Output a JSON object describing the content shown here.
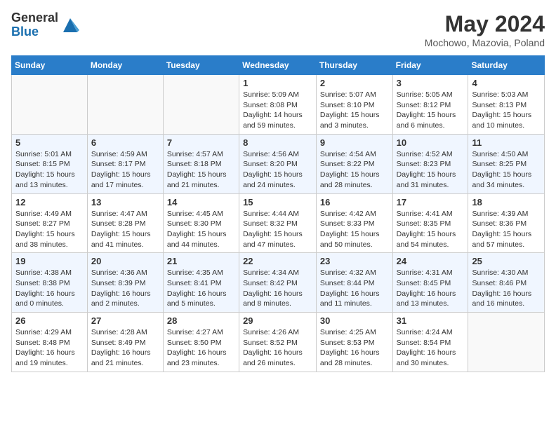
{
  "header": {
    "logo_general": "General",
    "logo_blue": "Blue",
    "title": "May 2024",
    "location": "Mochowo, Mazovia, Poland"
  },
  "days_of_week": [
    "Sunday",
    "Monday",
    "Tuesday",
    "Wednesday",
    "Thursday",
    "Friday",
    "Saturday"
  ],
  "weeks": [
    [
      {
        "day": "",
        "info": ""
      },
      {
        "day": "",
        "info": ""
      },
      {
        "day": "",
        "info": ""
      },
      {
        "day": "1",
        "info": "Sunrise: 5:09 AM\nSunset: 8:08 PM\nDaylight: 14 hours\nand 59 minutes."
      },
      {
        "day": "2",
        "info": "Sunrise: 5:07 AM\nSunset: 8:10 PM\nDaylight: 15 hours\nand 3 minutes."
      },
      {
        "day": "3",
        "info": "Sunrise: 5:05 AM\nSunset: 8:12 PM\nDaylight: 15 hours\nand 6 minutes."
      },
      {
        "day": "4",
        "info": "Sunrise: 5:03 AM\nSunset: 8:13 PM\nDaylight: 15 hours\nand 10 minutes."
      }
    ],
    [
      {
        "day": "5",
        "info": "Sunrise: 5:01 AM\nSunset: 8:15 PM\nDaylight: 15 hours\nand 13 minutes."
      },
      {
        "day": "6",
        "info": "Sunrise: 4:59 AM\nSunset: 8:17 PM\nDaylight: 15 hours\nand 17 minutes."
      },
      {
        "day": "7",
        "info": "Sunrise: 4:57 AM\nSunset: 8:18 PM\nDaylight: 15 hours\nand 21 minutes."
      },
      {
        "day": "8",
        "info": "Sunrise: 4:56 AM\nSunset: 8:20 PM\nDaylight: 15 hours\nand 24 minutes."
      },
      {
        "day": "9",
        "info": "Sunrise: 4:54 AM\nSunset: 8:22 PM\nDaylight: 15 hours\nand 28 minutes."
      },
      {
        "day": "10",
        "info": "Sunrise: 4:52 AM\nSunset: 8:23 PM\nDaylight: 15 hours\nand 31 minutes."
      },
      {
        "day": "11",
        "info": "Sunrise: 4:50 AM\nSunset: 8:25 PM\nDaylight: 15 hours\nand 34 minutes."
      }
    ],
    [
      {
        "day": "12",
        "info": "Sunrise: 4:49 AM\nSunset: 8:27 PM\nDaylight: 15 hours\nand 38 minutes."
      },
      {
        "day": "13",
        "info": "Sunrise: 4:47 AM\nSunset: 8:28 PM\nDaylight: 15 hours\nand 41 minutes."
      },
      {
        "day": "14",
        "info": "Sunrise: 4:45 AM\nSunset: 8:30 PM\nDaylight: 15 hours\nand 44 minutes."
      },
      {
        "day": "15",
        "info": "Sunrise: 4:44 AM\nSunset: 8:32 PM\nDaylight: 15 hours\nand 47 minutes."
      },
      {
        "day": "16",
        "info": "Sunrise: 4:42 AM\nSunset: 8:33 PM\nDaylight: 15 hours\nand 50 minutes."
      },
      {
        "day": "17",
        "info": "Sunrise: 4:41 AM\nSunset: 8:35 PM\nDaylight: 15 hours\nand 54 minutes."
      },
      {
        "day": "18",
        "info": "Sunrise: 4:39 AM\nSunset: 8:36 PM\nDaylight: 15 hours\nand 57 minutes."
      }
    ],
    [
      {
        "day": "19",
        "info": "Sunrise: 4:38 AM\nSunset: 8:38 PM\nDaylight: 16 hours\nand 0 minutes."
      },
      {
        "day": "20",
        "info": "Sunrise: 4:36 AM\nSunset: 8:39 PM\nDaylight: 16 hours\nand 2 minutes."
      },
      {
        "day": "21",
        "info": "Sunrise: 4:35 AM\nSunset: 8:41 PM\nDaylight: 16 hours\nand 5 minutes."
      },
      {
        "day": "22",
        "info": "Sunrise: 4:34 AM\nSunset: 8:42 PM\nDaylight: 16 hours\nand 8 minutes."
      },
      {
        "day": "23",
        "info": "Sunrise: 4:32 AM\nSunset: 8:44 PM\nDaylight: 16 hours\nand 11 minutes."
      },
      {
        "day": "24",
        "info": "Sunrise: 4:31 AM\nSunset: 8:45 PM\nDaylight: 16 hours\nand 13 minutes."
      },
      {
        "day": "25",
        "info": "Sunrise: 4:30 AM\nSunset: 8:46 PM\nDaylight: 16 hours\nand 16 minutes."
      }
    ],
    [
      {
        "day": "26",
        "info": "Sunrise: 4:29 AM\nSunset: 8:48 PM\nDaylight: 16 hours\nand 19 minutes."
      },
      {
        "day": "27",
        "info": "Sunrise: 4:28 AM\nSunset: 8:49 PM\nDaylight: 16 hours\nand 21 minutes."
      },
      {
        "day": "28",
        "info": "Sunrise: 4:27 AM\nSunset: 8:50 PM\nDaylight: 16 hours\nand 23 minutes."
      },
      {
        "day": "29",
        "info": "Sunrise: 4:26 AM\nSunset: 8:52 PM\nDaylight: 16 hours\nand 26 minutes."
      },
      {
        "day": "30",
        "info": "Sunrise: 4:25 AM\nSunset: 8:53 PM\nDaylight: 16 hours\nand 28 minutes."
      },
      {
        "day": "31",
        "info": "Sunrise: 4:24 AM\nSunset: 8:54 PM\nDaylight: 16 hours\nand 30 minutes."
      },
      {
        "day": "",
        "info": ""
      }
    ]
  ]
}
